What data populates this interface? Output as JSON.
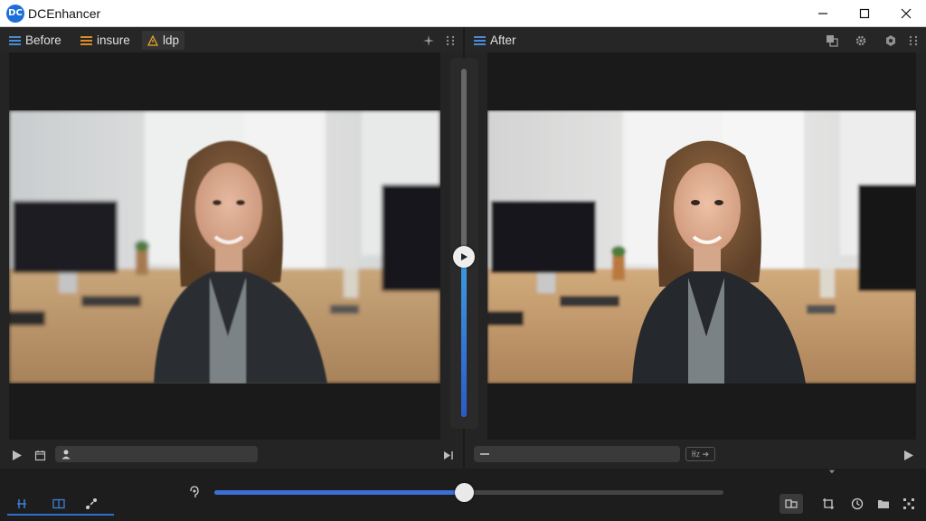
{
  "window": {
    "title": "DCEnhancer",
    "logo_text": "DC",
    "controls": [
      "minimize-icon",
      "maximize-icon",
      "close-icon"
    ]
  },
  "before_panel": {
    "tabs": [
      {
        "label": "Before",
        "icon": "menu-icon",
        "active": false
      },
      {
        "label": "insure",
        "icon": "menu-icon",
        "active": false
      },
      {
        "label": "ldp",
        "icon": "warning-icon",
        "active": true
      }
    ],
    "toolbar_icons": [
      "sparkle-icon",
      "drag-handle-icon"
    ],
    "bottom_icons": [
      "play-icon",
      "calendar-icon",
      "user-icon",
      "skip-forward-icon"
    ],
    "image_description": "original photo"
  },
  "after_panel": {
    "tabs": [
      {
        "label": "After",
        "icon": "menu-icon",
        "active": false
      }
    ],
    "toolbar_icons": [
      "layers-icon",
      "gear-icon",
      "settings-icon",
      "drag-handle-icon"
    ],
    "badge_label": "㎐ ➔",
    "bottom_icons": [
      "minus-icon",
      "play-icon"
    ]
  },
  "compare_slider": {
    "value": 0.46
  },
  "timeline": {
    "progress": 0.49,
    "mode_icons": [
      "split-view-icon",
      "side-by-side-icon",
      "magic-wand-icon"
    ],
    "right_icons": [
      "compare-icon",
      "crop-icon",
      "clock-icon",
      "folder-icon",
      "grid-icon"
    ]
  },
  "colors": {
    "accent": "#3b6fd6",
    "background": "#1b1b1b",
    "panel": "#242424"
  }
}
